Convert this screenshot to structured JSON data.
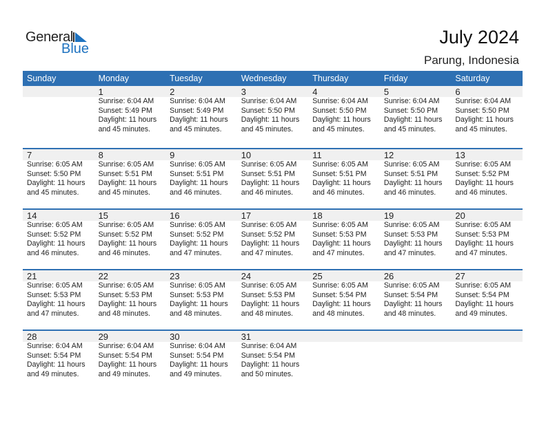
{
  "logo": {
    "line1": "General",
    "line2": "Blue",
    "brand_color": "#1f73c0"
  },
  "header": {
    "title": "July 2024",
    "location": "Parung, Indonesia"
  },
  "colors": {
    "header_bg": "#2e70b3",
    "day_number_bg": "#f0f0f0"
  },
  "weekdays": [
    "Sunday",
    "Monday",
    "Tuesday",
    "Wednesday",
    "Thursday",
    "Friday",
    "Saturday"
  ],
  "weeks": [
    [
      {
        "day": "",
        "sunrise": "",
        "sunset": "",
        "daylight": "",
        "minutes": ""
      },
      {
        "day": "1",
        "sunrise": "Sunrise: 6:04 AM",
        "sunset": "Sunset: 5:49 PM",
        "daylight": "Daylight: 11 hours",
        "minutes": "and 45 minutes."
      },
      {
        "day": "2",
        "sunrise": "Sunrise: 6:04 AM",
        "sunset": "Sunset: 5:49 PM",
        "daylight": "Daylight: 11 hours",
        "minutes": "and 45 minutes."
      },
      {
        "day": "3",
        "sunrise": "Sunrise: 6:04 AM",
        "sunset": "Sunset: 5:50 PM",
        "daylight": "Daylight: 11 hours",
        "minutes": "and 45 minutes."
      },
      {
        "day": "4",
        "sunrise": "Sunrise: 6:04 AM",
        "sunset": "Sunset: 5:50 PM",
        "daylight": "Daylight: 11 hours",
        "minutes": "and 45 minutes."
      },
      {
        "day": "5",
        "sunrise": "Sunrise: 6:04 AM",
        "sunset": "Sunset: 5:50 PM",
        "daylight": "Daylight: 11 hours",
        "minutes": "and 45 minutes."
      },
      {
        "day": "6",
        "sunrise": "Sunrise: 6:04 AM",
        "sunset": "Sunset: 5:50 PM",
        "daylight": "Daylight: 11 hours",
        "minutes": "and 45 minutes."
      }
    ],
    [
      {
        "day": "7",
        "sunrise": "Sunrise: 6:05 AM",
        "sunset": "Sunset: 5:50 PM",
        "daylight": "Daylight: 11 hours",
        "minutes": "and 45 minutes."
      },
      {
        "day": "8",
        "sunrise": "Sunrise: 6:05 AM",
        "sunset": "Sunset: 5:51 PM",
        "daylight": "Daylight: 11 hours",
        "minutes": "and 45 minutes."
      },
      {
        "day": "9",
        "sunrise": "Sunrise: 6:05 AM",
        "sunset": "Sunset: 5:51 PM",
        "daylight": "Daylight: 11 hours",
        "minutes": "and 46 minutes."
      },
      {
        "day": "10",
        "sunrise": "Sunrise: 6:05 AM",
        "sunset": "Sunset: 5:51 PM",
        "daylight": "Daylight: 11 hours",
        "minutes": "and 46 minutes."
      },
      {
        "day": "11",
        "sunrise": "Sunrise: 6:05 AM",
        "sunset": "Sunset: 5:51 PM",
        "daylight": "Daylight: 11 hours",
        "minutes": "and 46 minutes."
      },
      {
        "day": "12",
        "sunrise": "Sunrise: 6:05 AM",
        "sunset": "Sunset: 5:51 PM",
        "daylight": "Daylight: 11 hours",
        "minutes": "and 46 minutes."
      },
      {
        "day": "13",
        "sunrise": "Sunrise: 6:05 AM",
        "sunset": "Sunset: 5:52 PM",
        "daylight": "Daylight: 11 hours",
        "minutes": "and 46 minutes."
      }
    ],
    [
      {
        "day": "14",
        "sunrise": "Sunrise: 6:05 AM",
        "sunset": "Sunset: 5:52 PM",
        "daylight": "Daylight: 11 hours",
        "minutes": "and 46 minutes."
      },
      {
        "day": "15",
        "sunrise": "Sunrise: 6:05 AM",
        "sunset": "Sunset: 5:52 PM",
        "daylight": "Daylight: 11 hours",
        "minutes": "and 46 minutes."
      },
      {
        "day": "16",
        "sunrise": "Sunrise: 6:05 AM",
        "sunset": "Sunset: 5:52 PM",
        "daylight": "Daylight: 11 hours",
        "minutes": "and 47 minutes."
      },
      {
        "day": "17",
        "sunrise": "Sunrise: 6:05 AM",
        "sunset": "Sunset: 5:52 PM",
        "daylight": "Daylight: 11 hours",
        "minutes": "and 47 minutes."
      },
      {
        "day": "18",
        "sunrise": "Sunrise: 6:05 AM",
        "sunset": "Sunset: 5:53 PM",
        "daylight": "Daylight: 11 hours",
        "minutes": "and 47 minutes."
      },
      {
        "day": "19",
        "sunrise": "Sunrise: 6:05 AM",
        "sunset": "Sunset: 5:53 PM",
        "daylight": "Daylight: 11 hours",
        "minutes": "and 47 minutes."
      },
      {
        "day": "20",
        "sunrise": "Sunrise: 6:05 AM",
        "sunset": "Sunset: 5:53 PM",
        "daylight": "Daylight: 11 hours",
        "minutes": "and 47 minutes."
      }
    ],
    [
      {
        "day": "21",
        "sunrise": "Sunrise: 6:05 AM",
        "sunset": "Sunset: 5:53 PM",
        "daylight": "Daylight: 11 hours",
        "minutes": "and 47 minutes."
      },
      {
        "day": "22",
        "sunrise": "Sunrise: 6:05 AM",
        "sunset": "Sunset: 5:53 PM",
        "daylight": "Daylight: 11 hours",
        "minutes": "and 48 minutes."
      },
      {
        "day": "23",
        "sunrise": "Sunrise: 6:05 AM",
        "sunset": "Sunset: 5:53 PM",
        "daylight": "Daylight: 11 hours",
        "minutes": "and 48 minutes."
      },
      {
        "day": "24",
        "sunrise": "Sunrise: 6:05 AM",
        "sunset": "Sunset: 5:53 PM",
        "daylight": "Daylight: 11 hours",
        "minutes": "and 48 minutes."
      },
      {
        "day": "25",
        "sunrise": "Sunrise: 6:05 AM",
        "sunset": "Sunset: 5:54 PM",
        "daylight": "Daylight: 11 hours",
        "minutes": "and 48 minutes."
      },
      {
        "day": "26",
        "sunrise": "Sunrise: 6:05 AM",
        "sunset": "Sunset: 5:54 PM",
        "daylight": "Daylight: 11 hours",
        "minutes": "and 48 minutes."
      },
      {
        "day": "27",
        "sunrise": "Sunrise: 6:05 AM",
        "sunset": "Sunset: 5:54 PM",
        "daylight": "Daylight: 11 hours",
        "minutes": "and 49 minutes."
      }
    ],
    [
      {
        "day": "28",
        "sunrise": "Sunrise: 6:04 AM",
        "sunset": "Sunset: 5:54 PM",
        "daylight": "Daylight: 11 hours",
        "minutes": "and 49 minutes."
      },
      {
        "day": "29",
        "sunrise": "Sunrise: 6:04 AM",
        "sunset": "Sunset: 5:54 PM",
        "daylight": "Daylight: 11 hours",
        "minutes": "and 49 minutes."
      },
      {
        "day": "30",
        "sunrise": "Sunrise: 6:04 AM",
        "sunset": "Sunset: 5:54 PM",
        "daylight": "Daylight: 11 hours",
        "minutes": "and 49 minutes."
      },
      {
        "day": "31",
        "sunrise": "Sunrise: 6:04 AM",
        "sunset": "Sunset: 5:54 PM",
        "daylight": "Daylight: 11 hours",
        "minutes": "and 50 minutes."
      },
      {
        "day": "",
        "sunrise": "",
        "sunset": "",
        "daylight": "",
        "minutes": ""
      },
      {
        "day": "",
        "sunrise": "",
        "sunset": "",
        "daylight": "",
        "minutes": ""
      },
      {
        "day": "",
        "sunrise": "",
        "sunset": "",
        "daylight": "",
        "minutes": ""
      }
    ]
  ]
}
